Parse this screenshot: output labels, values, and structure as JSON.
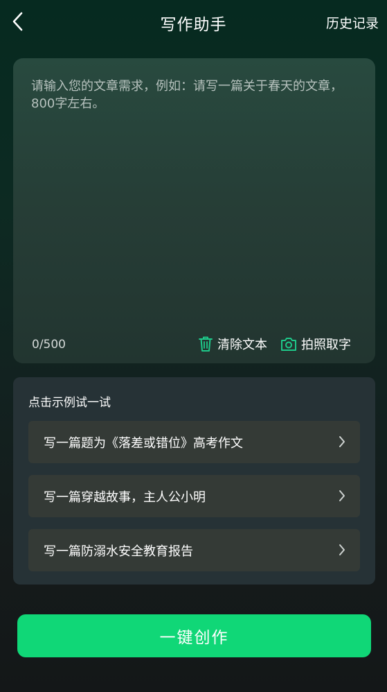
{
  "header": {
    "title": "写作助手",
    "history_label": "历史记录"
  },
  "input": {
    "placeholder": "请输入您的文章需求，例如：请写一篇关于春天的文章，800字左右。",
    "value": "",
    "char_count": "0/500"
  },
  "tools": {
    "clear_label": "清除文本",
    "photo_label": "拍照取字"
  },
  "examples": {
    "title": "点击示例试一试",
    "items": [
      {
        "label": "写一篇题为《落差或错位》高考作文"
      },
      {
        "label": "写一篇穿越故事，主人公小明"
      },
      {
        "label": "写一篇防溺水安全教育报告"
      }
    ]
  },
  "create_button": {
    "label": "一键创作"
  },
  "icons": {
    "back": "chevron-left-icon",
    "clear": "trash-icon",
    "photo": "camera-icon",
    "example_arrow": "chevron-right-icon"
  },
  "colors": {
    "accent": "#10d777",
    "icon_accent": "#1ec98a"
  }
}
